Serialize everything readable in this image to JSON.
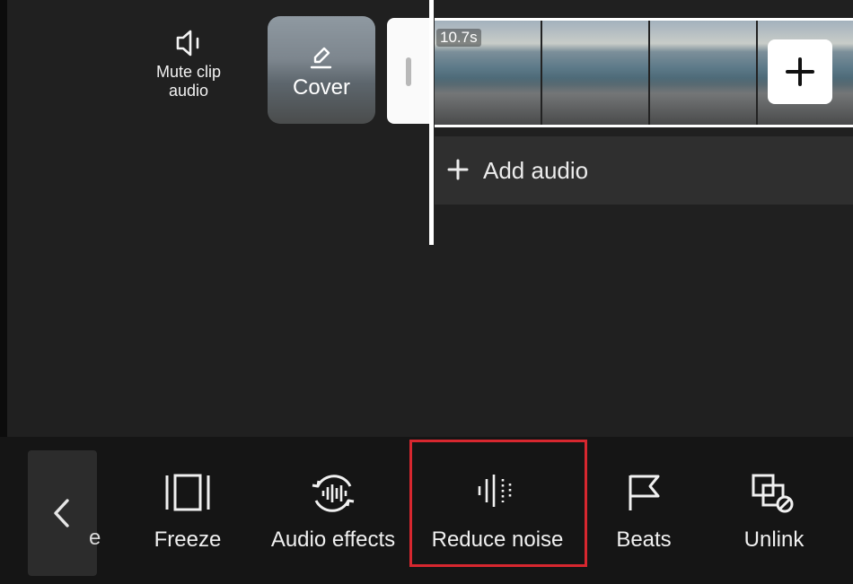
{
  "clip": {
    "mute_label": "Mute clip audio",
    "cover_label": "Cover",
    "duration": "10.7s",
    "add_audio_label": "Add audio"
  },
  "toolbar": {
    "partial_label": "e",
    "items": [
      {
        "label": "Freeze",
        "icon": "freeze-icon"
      },
      {
        "label": "Audio effects",
        "icon": "audio-effects-icon"
      },
      {
        "label": "Reduce noise",
        "icon": "reduce-noise-icon",
        "highlighted": true
      },
      {
        "label": "Beats",
        "icon": "flag-icon"
      },
      {
        "label": "Unlink",
        "icon": "unlink-icon"
      }
    ]
  },
  "colors": {
    "background": "#202020",
    "toolbar": "#151515",
    "highlight": "#d7272f",
    "text": "#ffffff"
  }
}
